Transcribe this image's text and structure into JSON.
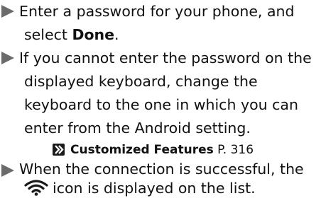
{
  "bullets": [
    {
      "line1": "Enter a password for your phone, and",
      "line2_prefix": "select ",
      "line2_bold": "Done",
      "line2_suffix": "."
    },
    {
      "line1": "If you cannot enter the password on the",
      "line2": "displayed keyboard, change the",
      "line3": "keyboard to the one in which you can",
      "line4": "enter from the Android setting.",
      "cross_reference": {
        "title": "Customized Features",
        "page": "P. 316"
      }
    },
    {
      "line1": "When the connection is successful, the",
      "line2_suffix": "icon is displayed on the list."
    }
  ],
  "icons": {
    "bullet": "right-triangle-icon",
    "cross_reference": "cross-reference-arrow-icon",
    "connection": "wifi-icon"
  },
  "colors": {
    "bullet_arrow": "#6b6b6b",
    "text": "#111111"
  }
}
